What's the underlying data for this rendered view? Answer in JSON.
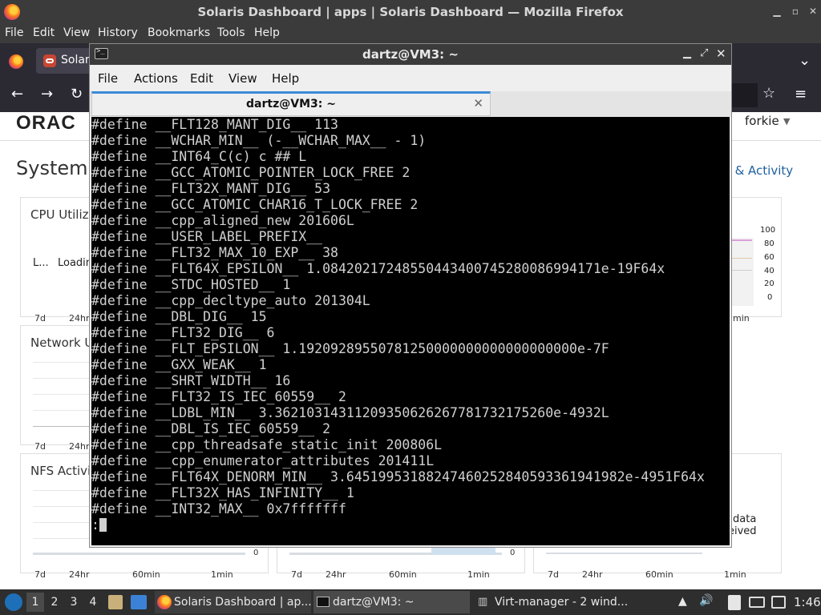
{
  "firefox": {
    "window_title": "Solaris Dashboard | apps | Solaris Dashboard — Mozilla Firefox",
    "menu": [
      "File",
      "Edit",
      "View",
      "History",
      "Bookmarks",
      "Tools",
      "Help"
    ],
    "tab_label": "Solar"
  },
  "page": {
    "logo": "ORAC",
    "user": "forkie",
    "title": "System",
    "right_title": "s & Activity",
    "cards": {
      "cpu": {
        "title": "CPU Utiliza",
        "legend_1": "L...",
        "legend_2": "Loadin",
        "ranges": [
          "7d",
          "24hr"
        ]
      },
      "network": {
        "title": "Network U",
        "ranges": [
          "7d",
          "24hr"
        ]
      },
      "nfs": {
        "title": "NFS Activit",
        "ranges": [
          "7d",
          "24hr",
          "60min",
          "1min"
        ],
        "zero": "0"
      },
      "middle_bottom": {
        "ranges": [
          "7d",
          "24hr",
          "60min",
          "1min"
        ],
        "zero": "0"
      },
      "right_bottom": {
        "ranges": [
          "7d",
          "24hr",
          "60min",
          "1min"
        ],
        "note_1": "data",
        "note_2": "eived"
      },
      "right_top": {
        "axis": [
          "100",
          "80",
          "60",
          "40",
          "20",
          "0"
        ],
        "range": "min"
      }
    }
  },
  "terminal": {
    "window_title": "dartz@VM3: ~",
    "menu": [
      "File",
      "Actions",
      "Edit",
      "View",
      "Help"
    ],
    "tab_label": "dartz@VM3: ~",
    "lines": [
      "#define __FLT128_MANT_DIG__ 113",
      "#define __WCHAR_MIN__ (-__WCHAR_MAX__ - 1)",
      "#define __INT64_C(c) c ## L",
      "#define __GCC_ATOMIC_POINTER_LOCK_FREE 2",
      "#define __FLT32X_MANT_DIG__ 53",
      "#define __GCC_ATOMIC_CHAR16_T_LOCK_FREE 2",
      "#define __cpp_aligned_new 201606L",
      "#define __USER_LABEL_PREFIX__",
      "#define __FLT32_MAX_10_EXP__ 38",
      "#define __FLT64X_EPSILON__ 1.08420217248550443400745280086994171e-19F64x",
      "#define __STDC_HOSTED__ 1",
      "#define __cpp_decltype_auto 201304L",
      "#define __DBL_DIG__ 15",
      "#define __FLT32_DIG__ 6",
      "#define __FLT_EPSILON__ 1.19209289550781250000000000000000000e-7F",
      "#define __GXX_WEAK__ 1",
      "#define __SHRT_WIDTH__ 16",
      "#define __FLT32_IS_IEC_60559__ 2",
      "#define __LDBL_MIN__ 3.36210314311209350626267781732175260e-4932L",
      "#define __DBL_IS_IEC_60559__ 2",
      "#define __cpp_threadsafe_static_init 200806L",
      "#define __cpp_enumerator_attributes 201411L",
      "#define __FLT64X_DENORM_MIN__ 3.64519953188247460252840593361941982e-4951F64x",
      "#define __FLT32X_HAS_INFINITY__ 1",
      "#define __INT32_MAX__ 0x7fffffff"
    ],
    "prompt": ":"
  },
  "taskbar": {
    "workspaces": [
      "1",
      "2",
      "3",
      "4"
    ],
    "tasks": [
      "Solaris Dashboard | ap...",
      "dartz@VM3: ~",
      "Virt-manager - 2 wind..."
    ],
    "clock": "1:46"
  }
}
